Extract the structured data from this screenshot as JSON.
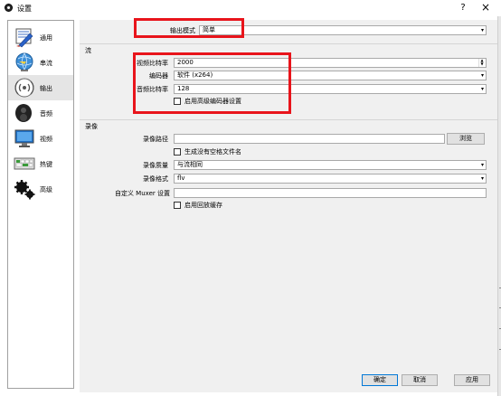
{
  "window": {
    "title": "设置",
    "help": "?",
    "close": "×"
  },
  "sidebar": {
    "items": [
      {
        "label": "通用",
        "icon": "settings-icon"
      },
      {
        "label": "串流",
        "icon": "stream-globe-icon"
      },
      {
        "label": "输出",
        "icon": "output-signal-icon",
        "active": true
      },
      {
        "label": "音频",
        "icon": "speaker-icon"
      },
      {
        "label": "视频",
        "icon": "monitor-icon"
      },
      {
        "label": "热键",
        "icon": "keyboard-icon"
      },
      {
        "label": "高级",
        "icon": "gears-icon"
      }
    ]
  },
  "output_mode": {
    "label": "输出模式",
    "value": "简单"
  },
  "streaming": {
    "title": "流",
    "video_bitrate": {
      "label": "视频比特率",
      "value": "2000"
    },
    "encoder": {
      "label": "编码器",
      "value": "软件 (x264)"
    },
    "audio_bitrate": {
      "label": "音频比特率",
      "value": "128"
    },
    "advanced_encoder": {
      "label": "启用高级编码器设置"
    }
  },
  "recording": {
    "title": "录像",
    "path": {
      "label": "录像路径",
      "browse": "浏览"
    },
    "no_space": {
      "label": "生成没有空格文件名"
    },
    "quality": {
      "label": "录像质量",
      "value": "与流相同"
    },
    "format": {
      "label": "录像格式",
      "value": "flv"
    },
    "muxer": {
      "label": "自定义 Muxer 设置",
      "value": ""
    },
    "replay_buffer": {
      "label": "启用回放缓存"
    }
  },
  "buttons": {
    "ok": "确定",
    "cancel": "取消",
    "apply": "应用"
  },
  "colors": {
    "highlight": "#e8141b",
    "accent": "#0078d7"
  }
}
